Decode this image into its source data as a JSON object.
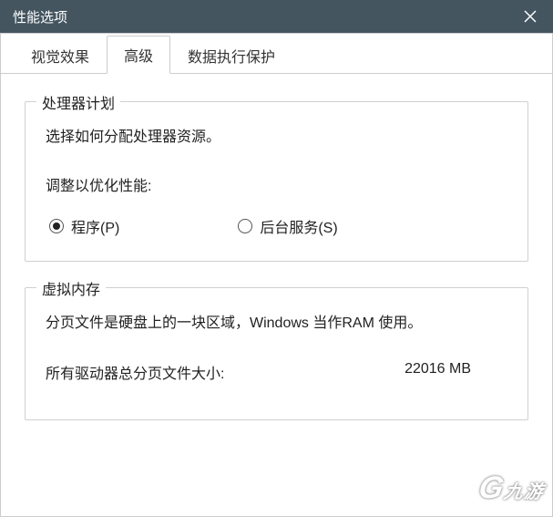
{
  "window": {
    "title": "性能选项"
  },
  "tabs": {
    "visual": "视觉效果",
    "advanced": "高级",
    "dep": "数据执行保护"
  },
  "processor": {
    "group_title": "处理器计划",
    "description": "选择如何分配处理器资源。",
    "adjust_label": "调整以优化性能:",
    "radio_programs": "程序(P)",
    "radio_background": "后台服务(S)"
  },
  "vm": {
    "group_title": "虚拟内存",
    "description": "分页文件是硬盘上的一块区域，Windows 当作RAM 使用。",
    "total_label": "所有驱动器总分页文件大小:",
    "total_value": "22016 MB"
  },
  "watermark": {
    "g": "G",
    "text": "九游"
  }
}
